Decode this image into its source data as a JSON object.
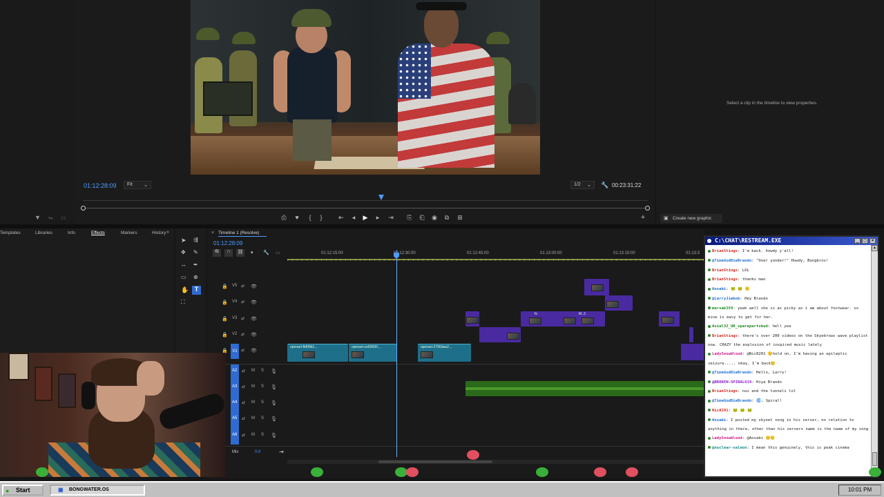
{
  "program_monitor": {
    "timecode_current": "01:12:28:09",
    "fit_label": "Fit",
    "resolution": "1/2",
    "timecode_total": "00:23:31:22"
  },
  "properties": {
    "hint": "Select a clip in the timeline to view properties.",
    "create_graphic": "Create new graphic"
  },
  "effects_tabs": [
    "Templates",
    "Libraries",
    "Info",
    "Effects",
    "Markers",
    "History"
  ],
  "timeline": {
    "title": "Timeline 1 (Resolve)",
    "timecode": "01:12:28:09",
    "ticks": [
      "01:12:15:00",
      "01:12:30:00",
      "01:12:45:00",
      "01:13:00:00",
      "01:13:15:00",
      "01:13:3"
    ],
    "video_tracks": [
      "V5",
      "V4",
      "V3",
      "V2",
      "V1"
    ],
    "audio_tracks": [
      "A2",
      "A3",
      "A4",
      "A5",
      "A6"
    ],
    "mix_label": "Mix",
    "mix_value": "0.0",
    "clips": {
      "c1": "openart-fbf08b1...",
      "c2": "openart-ce60600...",
      "c3": "openart-2790daa2...",
      "fx1": "fx",
      "fx2": "M..2."
    }
  },
  "chat": {
    "title": "C:\\CHAT\\RESTREAM.EXE",
    "messages": [
      {
        "user": "BrianStings",
        "text": "I'm back. howdy y'all!",
        "color": "#d2261d"
      },
      {
        "user": "@TimeGodDieBrando",
        "text": "\"Over yonder!\" Howdy, Bongbros!",
        "color": "#1f6fd0"
      },
      {
        "user": "BrianStings",
        "text": "LOL",
        "color": "#d2261d"
      },
      {
        "user": "BrianStings",
        "text": "thanks man",
        "color": "#d2261d"
      },
      {
        "user": "Aosabi",
        "text": "🐸 🐸 🙂",
        "color": "#1f6fd0"
      },
      {
        "user": "@LarryJimbob",
        "text": "Hey Brando",
        "color": "#1f6fd0"
      },
      {
        "user": "mervak359",
        "text": "yeah well she is as picky as i am about footwear. so mine is easy to get for her.",
        "color": "#1a8a1a",
        "wrap": true
      },
      {
        "user": "Axial32_UR_spareparts​bud",
        "text": "hell yea",
        "color": "#1a8a1a"
      },
      {
        "user": "BrianStings",
        "text": "there's over 200 videos on the Skyebrows wave playlist now. CRAZY the explosion of inspired music lately",
        "color": "#d2261d",
        "wrap": true
      },
      {
        "user": "LadySnowblood",
        "text": "@Nic8201 🙂hold on, I'm having an epileptic seizure..... okay, I'm back🙂",
        "color": "#c21a8a",
        "wrap": true
      },
      {
        "user": "@TimeGodDieBrando",
        "text": "Hello, Larry!",
        "color": "#1f6fd0"
      },
      {
        "user": "@BROKEN-SPIRAL619",
        "text": "Hiya Brando",
        "color": "#8a1ad0"
      },
      {
        "user": "BrianStings",
        "text": "nux and the tunnels lol",
        "color": "#d2261d"
      },
      {
        "user": "@TimeGodDieBrando",
        "text": "🌀, Spiral!",
        "color": "#1f6fd0"
      },
      {
        "user": "Nic8201",
        "text": "🐸 🐸 🐸",
        "color": "#d2261d"
      },
      {
        "user": "Aosabi",
        "text": "I posted my skynet song in his server, no relation to anything in there, other than his servers name is the name of my song",
        "color": "#1f6fd0",
        "wrap": true
      },
      {
        "user": "LadySnowblood",
        "text": "@Aosabi 🙂🙂",
        "color": "#c21a8a"
      },
      {
        "user": "@nuclear-salmon",
        "text": "I mean this genuinely, this is peak cinema",
        "color": "#1a8a8a"
      }
    ]
  },
  "taskbar": {
    "start": "Start",
    "task": "BONGWATER.OS",
    "clock": "10:01 PM"
  }
}
